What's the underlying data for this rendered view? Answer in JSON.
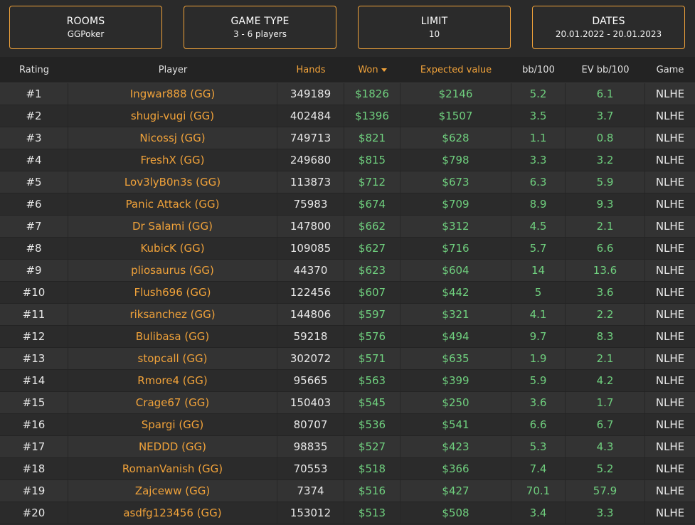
{
  "filters": [
    {
      "title": "ROOMS",
      "value": "GGPoker"
    },
    {
      "title": "GAME TYPE",
      "value": "3 - 6 players"
    },
    {
      "title": "LIMIT",
      "value": "10"
    },
    {
      "title": "DATES",
      "value": "20.01.2022 - 20.01.2023"
    }
  ],
  "table": {
    "headers": {
      "rating": "Rating",
      "player": "Player",
      "hands": "Hands",
      "won": "Won",
      "expected_value": "Expected value",
      "bb100": "bb/100",
      "ev_bb100": "EV bb/100",
      "game": "Game"
    },
    "sort_icon": "caret-down-icon",
    "rows": [
      {
        "rating": "#1",
        "player": "Ingwar888 (GG)",
        "hands": "349189",
        "won": "$1826",
        "ev": "$2146",
        "bb100": "5.2",
        "evbb100": "6.1",
        "game": "NLHE"
      },
      {
        "rating": "#2",
        "player": "shugi-vugi (GG)",
        "hands": "402484",
        "won": "$1396",
        "ev": "$1507",
        "bb100": "3.5",
        "evbb100": "3.7",
        "game": "NLHE"
      },
      {
        "rating": "#3",
        "player": "Nicossj (GG)",
        "hands": "749713",
        "won": "$821",
        "ev": "$628",
        "bb100": "1.1",
        "evbb100": "0.8",
        "game": "NLHE"
      },
      {
        "rating": "#4",
        "player": "FreshX (GG)",
        "hands": "249680",
        "won": "$815",
        "ev": "$798",
        "bb100": "3.3",
        "evbb100": "3.2",
        "game": "NLHE"
      },
      {
        "rating": "#5",
        "player": "Lov3lyB0n3s (GG)",
        "hands": "113873",
        "won": "$712",
        "ev": "$673",
        "bb100": "6.3",
        "evbb100": "5.9",
        "game": "NLHE"
      },
      {
        "rating": "#6",
        "player": "Panic Attack (GG)",
        "hands": "75983",
        "won": "$674",
        "ev": "$709",
        "bb100": "8.9",
        "evbb100": "9.3",
        "game": "NLHE"
      },
      {
        "rating": "#7",
        "player": "Dr Salami (GG)",
        "hands": "147800",
        "won": "$662",
        "ev": "$312",
        "bb100": "4.5",
        "evbb100": "2.1",
        "game": "NLHE"
      },
      {
        "rating": "#8",
        "player": "KubicK (GG)",
        "hands": "109085",
        "won": "$627",
        "ev": "$716",
        "bb100": "5.7",
        "evbb100": "6.6",
        "game": "NLHE"
      },
      {
        "rating": "#9",
        "player": "pliosaurus (GG)",
        "hands": "44370",
        "won": "$623",
        "ev": "$604",
        "bb100": "14",
        "evbb100": "13.6",
        "game": "NLHE"
      },
      {
        "rating": "#10",
        "player": "Flush696 (GG)",
        "hands": "122456",
        "won": "$607",
        "ev": "$442",
        "bb100": "5",
        "evbb100": "3.6",
        "game": "NLHE"
      },
      {
        "rating": "#11",
        "player": "riksanchez (GG)",
        "hands": "144806",
        "won": "$597",
        "ev": "$321",
        "bb100": "4.1",
        "evbb100": "2.2",
        "game": "NLHE"
      },
      {
        "rating": "#12",
        "player": "Bulibasa (GG)",
        "hands": "59218",
        "won": "$576",
        "ev": "$494",
        "bb100": "9.7",
        "evbb100": "8.3",
        "game": "NLHE"
      },
      {
        "rating": "#13",
        "player": "stopcall (GG)",
        "hands": "302072",
        "won": "$571",
        "ev": "$635",
        "bb100": "1.9",
        "evbb100": "2.1",
        "game": "NLHE"
      },
      {
        "rating": "#14",
        "player": "Rmore4 (GG)",
        "hands": "95665",
        "won": "$563",
        "ev": "$399",
        "bb100": "5.9",
        "evbb100": "4.2",
        "game": "NLHE"
      },
      {
        "rating": "#15",
        "player": "Crage67 (GG)",
        "hands": "150403",
        "won": "$545",
        "ev": "$250",
        "bb100": "3.6",
        "evbb100": "1.7",
        "game": "NLHE"
      },
      {
        "rating": "#16",
        "player": "Spargi (GG)",
        "hands": "80707",
        "won": "$536",
        "ev": "$541",
        "bb100": "6.6",
        "evbb100": "6.7",
        "game": "NLHE"
      },
      {
        "rating": "#17",
        "player": "NEDDD (GG)",
        "hands": "98835",
        "won": "$527",
        "ev": "$423",
        "bb100": "5.3",
        "evbb100": "4.3",
        "game": "NLHE"
      },
      {
        "rating": "#18",
        "player": "RomanVanish (GG)",
        "hands": "70553",
        "won": "$518",
        "ev": "$366",
        "bb100": "7.4",
        "evbb100": "5.2",
        "game": "NLHE"
      },
      {
        "rating": "#19",
        "player": "Zajceww (GG)",
        "hands": "7374",
        "won": "$516",
        "ev": "$427",
        "bb100": "70.1",
        "evbb100": "57.9",
        "game": "NLHE"
      },
      {
        "rating": "#20",
        "player": "asdfg123456 (GG)",
        "hands": "153012",
        "won": "$513",
        "ev": "$508",
        "bb100": "3.4",
        "evbb100": "3.3",
        "game": "NLHE"
      }
    ]
  },
  "colors": {
    "accent": "#f0a23a",
    "money": "#6fcf7e",
    "background": "#2a2a2a"
  }
}
